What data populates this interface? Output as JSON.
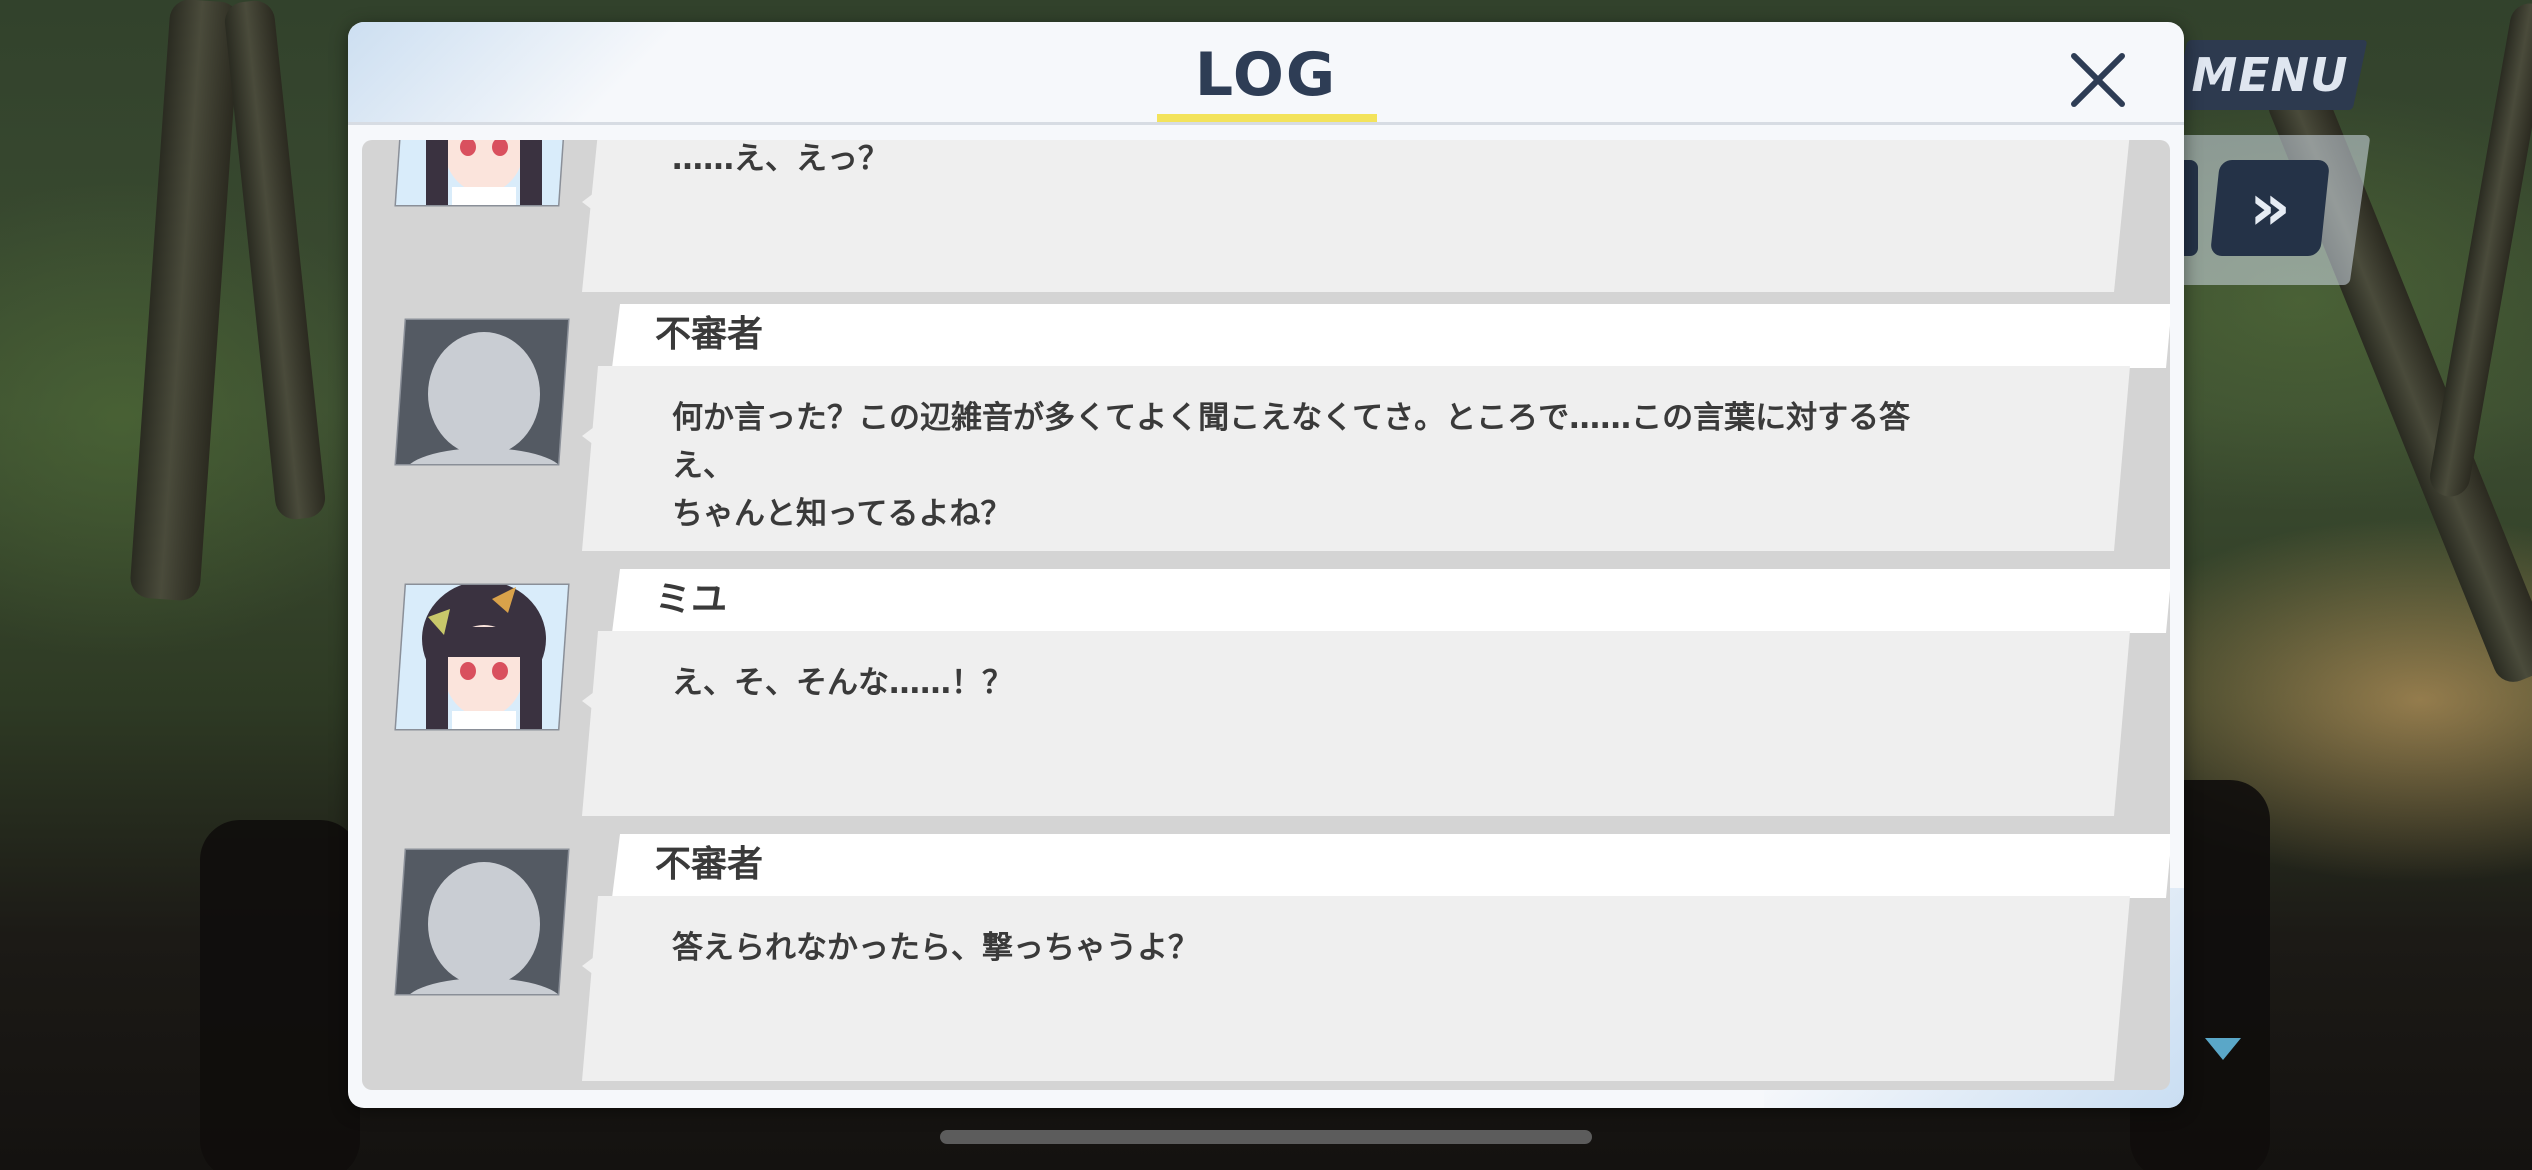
{
  "dialog": {
    "title": "LOG",
    "close_label": "close"
  },
  "menu": {
    "label": "MENU",
    "fast_forward": "»"
  },
  "log": [
    {
      "speaker": "",
      "avatar": "girl-portrait",
      "text": "……え、えっ？"
    },
    {
      "speaker": "不審者",
      "avatar": "silhouette",
      "text": "何か言った？この辺雑音が多くてよく聞こえなくてさ。ところで……この言葉に対する答え、\nちゃんと知ってるよね？"
    },
    {
      "speaker": "ミユ",
      "avatar": "girl-portrait",
      "text": "え、そ、そんな……！？"
    },
    {
      "speaker": "不審者",
      "avatar": "silhouette",
      "text": "答えられなかったら、撃っちゃうよ？"
    }
  ],
  "colors": {
    "title_text": "#2e3d55",
    "title_underline": "#f3e35b",
    "menu_bg": "#2d3a4f",
    "panel_bg": "#d4d4d4",
    "bubble_bg": "#efefef",
    "name_tab_bg": "#ffffff"
  }
}
